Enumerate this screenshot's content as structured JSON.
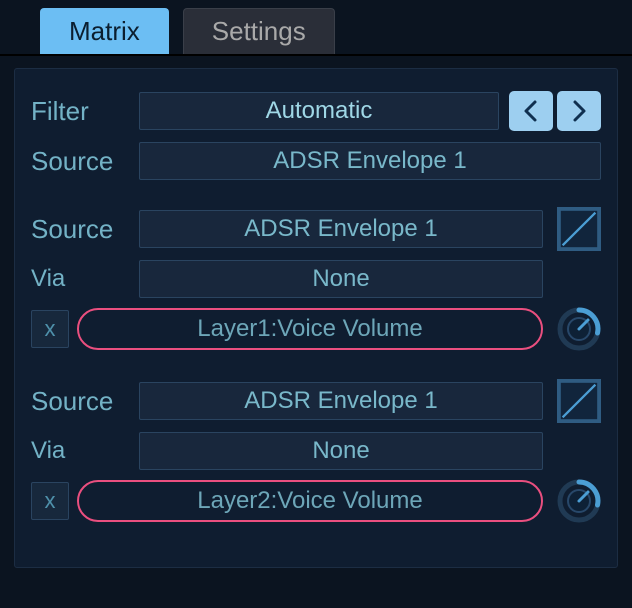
{
  "tabs": {
    "matrix": "Matrix",
    "settings": "Settings"
  },
  "labels": {
    "filter": "Filter",
    "source": "Source",
    "via": "Via"
  },
  "filter": {
    "value": "Automatic"
  },
  "global_source": {
    "value": "ADSR Envelope 1"
  },
  "slots": [
    {
      "source": "ADSR Envelope 1",
      "via": "None",
      "x": "x",
      "destination": "Layer1:Voice Volume"
    },
    {
      "source": "ADSR Envelope 1",
      "via": "None",
      "x": "x",
      "destination": "Layer2:Voice Volume"
    }
  ],
  "icons": {
    "prev": "prev-icon",
    "next": "next-icon",
    "curve": "curve-icon",
    "knob": "amount-knob-icon"
  },
  "colors": {
    "accent": "#6cbef3",
    "highlight": "#ea4f7f",
    "text": "#79b8ca"
  }
}
